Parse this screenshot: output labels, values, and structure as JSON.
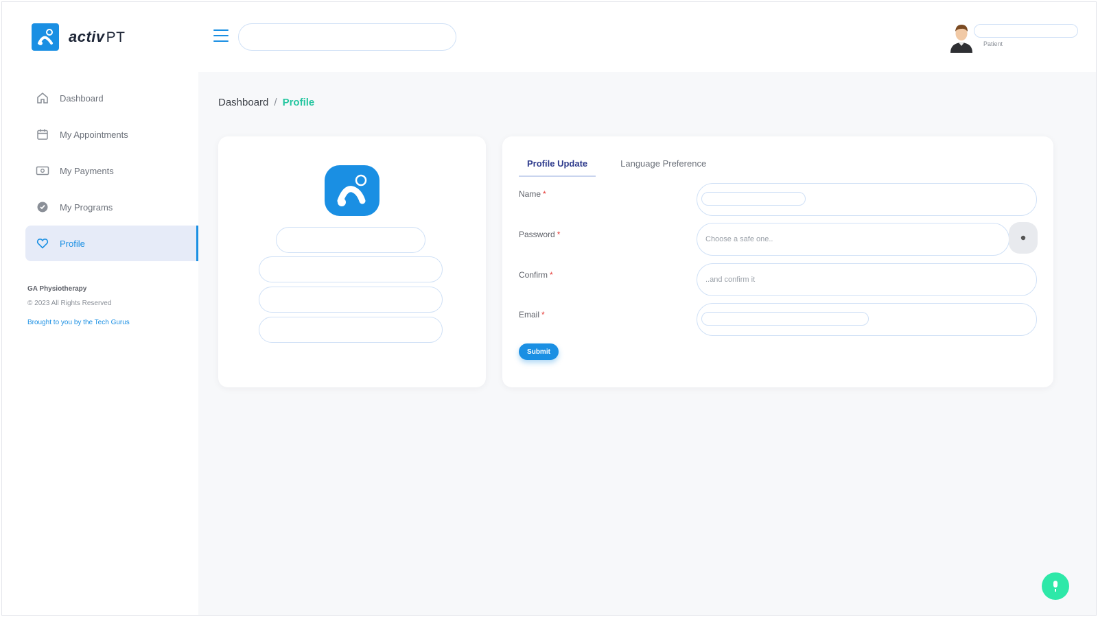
{
  "brand": {
    "name_bold": "activ",
    "name_light": "PT",
    "accent": "#1a8fe3"
  },
  "sidebar": {
    "items": [
      {
        "label": "Dashboard",
        "icon": "home-icon"
      },
      {
        "label": "My Appointments",
        "icon": "calendar-icon"
      },
      {
        "label": "My Payments",
        "icon": "payment-icon"
      },
      {
        "label": "My Programs",
        "icon": "program-icon"
      },
      {
        "label": "Profile",
        "icon": "heart-icon",
        "active": true
      }
    ],
    "footer": {
      "company": "GA Physiotherapy",
      "copyright": "© 2023 All Rights Reserved",
      "credit": "Brought to you by the Tech Gurus"
    }
  },
  "header": {
    "search": {
      "value": "",
      "placeholder": ""
    },
    "user": {
      "name": "",
      "role": "Patient"
    }
  },
  "breadcrumb": {
    "root": "Dashboard",
    "separator": "/",
    "current": "Profile"
  },
  "profile_card": {
    "icon": "activpt-logo-icon",
    "name": "",
    "line1": "",
    "line2": "",
    "line3": ""
  },
  "tabs": [
    {
      "label": "Profile Update",
      "active": true
    },
    {
      "label": "Language Preference",
      "active": false
    }
  ],
  "form": {
    "name": {
      "label": "Name",
      "value": ""
    },
    "password": {
      "label": "Password",
      "value": "",
      "placeholder": "Choose a safe one.."
    },
    "confirm": {
      "label": "Confirm",
      "value": "",
      "placeholder": "..and confirm it"
    },
    "email": {
      "label": "Email",
      "value": ""
    },
    "required_mark": "*",
    "submit_label": "Submit"
  },
  "colors": {
    "accent": "#1a8fe3",
    "breadcrumb_active": "#26c6a0",
    "fab": "#2ee8a8",
    "required": "#e53935"
  }
}
